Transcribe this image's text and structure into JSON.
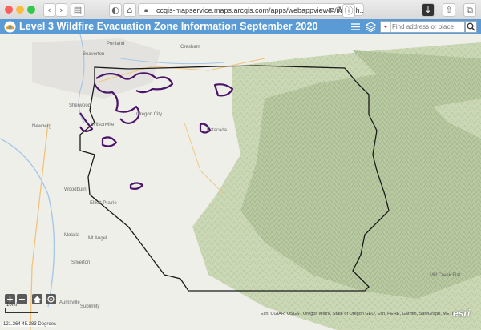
{
  "browser": {
    "url": "ccgis-mapservice.maps.arcgis.com/apps/webappviewer/index.h..."
  },
  "app": {
    "title": "Level 3 Wildfire Evacuation Zone Information September 2020",
    "header_color": "#5b9bd5",
    "icons": [
      "list-icon",
      "layers-icon"
    ]
  },
  "search": {
    "placeholder": "Find address or place"
  },
  "map": {
    "place_labels": {
      "portland": "Portland",
      "beaverton": "Beaverton",
      "gresham": "Gresham",
      "sherwood": "Sherwood",
      "oregon_city": "Oregon City",
      "newberg": "Newberg",
      "wilsonville": "Wilsonville",
      "molalla": "Molalla",
      "woodburn": "Woodburn",
      "estacada": "Estacada",
      "elliott_prairie": "Elliott Prairie",
      "mt_angel": "Mt Angel",
      "silverton": "Silverton",
      "mill_creek_flat": "Mill Creek Flat",
      "sublimity": "Sublimity",
      "aumsville": "Aumsville"
    },
    "zoom_in": "+",
    "zoom_out": "−",
    "scale_label": "10mi",
    "coordinates": "-121.364 45.283 Degrees",
    "attribution": "Esri, CGIAR, USGS | Oregon Metro, State of Oregon GEO, Esri, HERE, Garmin, SafeGraph, METI...",
    "logo": "esri",
    "evacuation_color": "#4b1469",
    "boundary_color": "#1a1a1a"
  }
}
